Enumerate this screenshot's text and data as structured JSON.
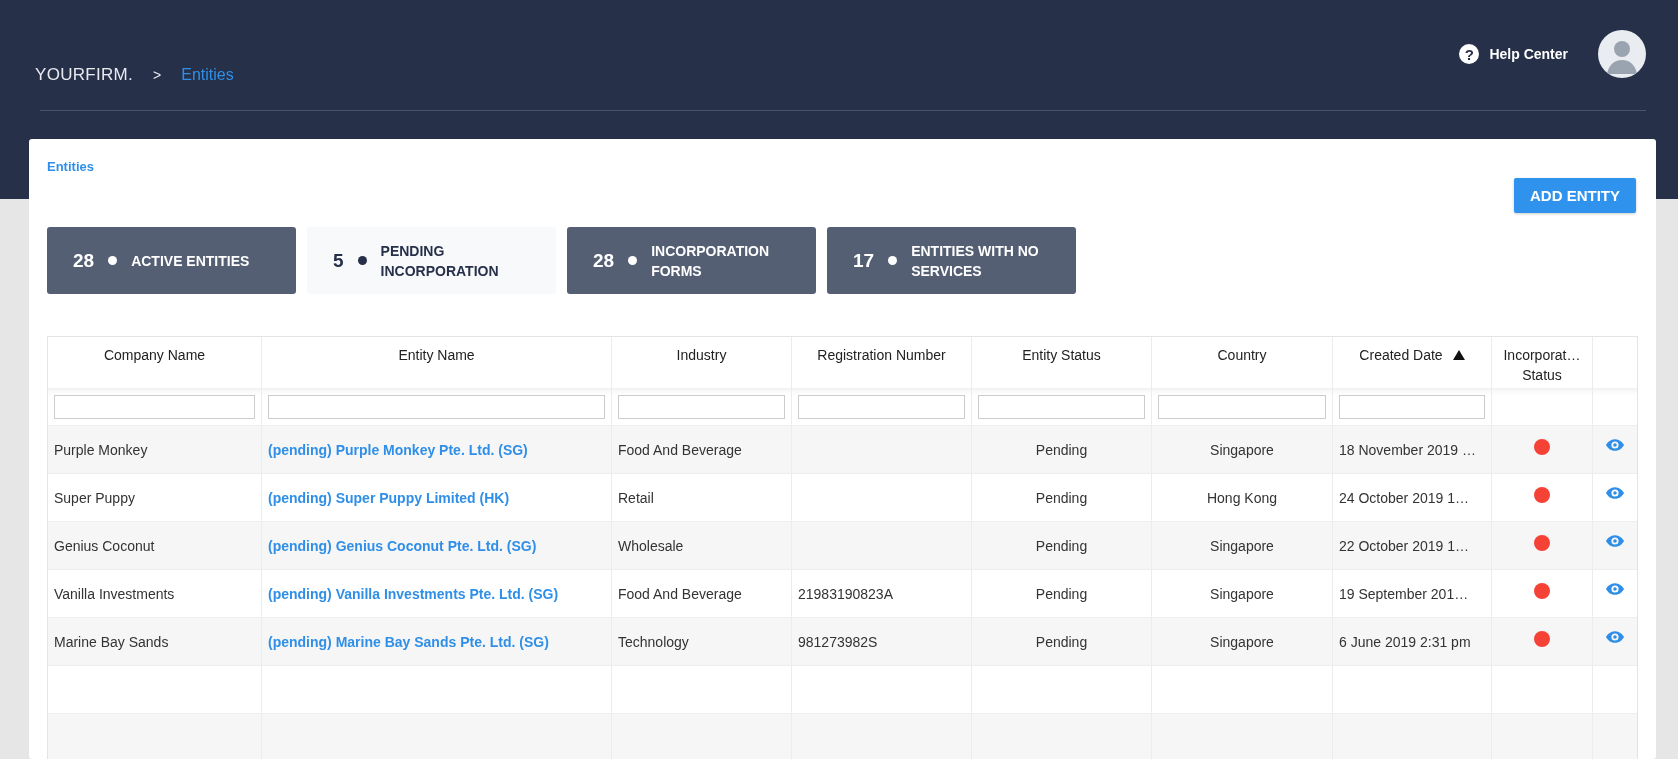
{
  "header": {
    "brand": "YOURFIRM.",
    "separator": ">",
    "crumb": "Entities",
    "help_icon": "?",
    "help_label": "Help Center"
  },
  "card": {
    "title": "Entities",
    "add_button": "ADD ENTITY"
  },
  "tabs": [
    {
      "count": "28",
      "label": "ACTIVE ENTITIES",
      "selected": false
    },
    {
      "count": "5",
      "label": "PENDING INCORPORATION",
      "selected": true
    },
    {
      "count": "28",
      "label": "INCORPORATION FORMS",
      "selected": false
    },
    {
      "count": "17",
      "label": "ENTITIES WITH NO SERVICES",
      "selected": false
    }
  ],
  "table": {
    "columns": [
      {
        "label": "Company Name",
        "filter": true
      },
      {
        "label": "Entity Name",
        "filter": true
      },
      {
        "label": "Industry",
        "filter": true
      },
      {
        "label": "Registration Number",
        "filter": true
      },
      {
        "label": "Entity Status",
        "filter": true
      },
      {
        "label": "Country",
        "filter": true
      },
      {
        "label": "Created Date",
        "filter": true,
        "sort_ascending": true
      },
      {
        "label": "Incorporat… Status",
        "filter": false
      }
    ],
    "rows": [
      {
        "company": "Purple Monkey",
        "entity": "(pending) Purple Monkey Pte. Ltd. (SG)",
        "industry": "Food And Beverage",
        "registration": "",
        "status": "Pending",
        "country": "Singapore",
        "created": "18 November 2019 …",
        "color": "#f44336"
      },
      {
        "company": "Super Puppy",
        "entity": "(pending) Super Puppy Limited (HK)",
        "industry": "Retail",
        "registration": "",
        "status": "Pending",
        "country": "Hong Kong",
        "created": "24 October 2019 1…",
        "color": "#f44336"
      },
      {
        "company": "Genius Coconut",
        "entity": "(pending) Genius Coconut Pte. Ltd. (SG)",
        "industry": "Wholesale",
        "registration": "",
        "status": "Pending",
        "country": "Singapore",
        "created": "22 October 2019 1…",
        "color": "#f44336"
      },
      {
        "company": "Vanilla Investments",
        "entity": "(pending) Vanilla Investments Pte. Ltd. (SG)",
        "industry": "Food And Beverage",
        "registration": "21983190823A",
        "status": "Pending",
        "country": "Singapore",
        "created": "19 September 201…",
        "color": "#f44336"
      },
      {
        "company": "Marine Bay Sands",
        "entity": "(pending) Marine Bay Sands Pte. Ltd. (SG)",
        "industry": "Technology",
        "registration": "981273982S",
        "status": "Pending",
        "country": "Singapore",
        "created": "6 June 2019 2:31 pm",
        "color": "#f44336"
      }
    ]
  }
}
